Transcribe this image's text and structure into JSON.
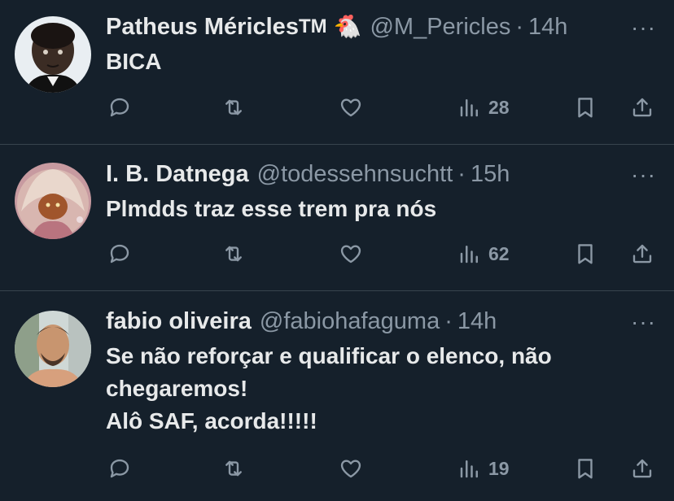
{
  "tweets": [
    {
      "name": "Patheus Méricles",
      "tm": "TM",
      "emoji": "🐔",
      "handle": "@M_Pericles",
      "sep": "·",
      "time": "14h",
      "text": "BICA",
      "views": "28"
    },
    {
      "name": "I. B. Datnega",
      "tm": "",
      "emoji": "",
      "handle": "@todessehnsuchtt",
      "sep": "·",
      "time": "15h",
      "text": "Plmdds traz esse trem pra nós",
      "views": "62"
    },
    {
      "name": "fabio oliveira",
      "tm": "",
      "emoji": "",
      "handle": "@fabiohafaguma",
      "sep": "·",
      "time": "14h",
      "text": "Se não reforçar e qualificar o elenco, não\nchegaremos!\nAlô SAF, acorda!!!!!",
      "views": "19"
    }
  ],
  "more_glyph": "···",
  "colors": {
    "background": "#15202b",
    "text": "#e7e9ea",
    "muted": "#8b98a5",
    "divider": "#38444d"
  },
  "icons": [
    "reply-icon",
    "retweet-icon",
    "like-icon",
    "views-icon",
    "bookmark-icon",
    "share-icon"
  ]
}
